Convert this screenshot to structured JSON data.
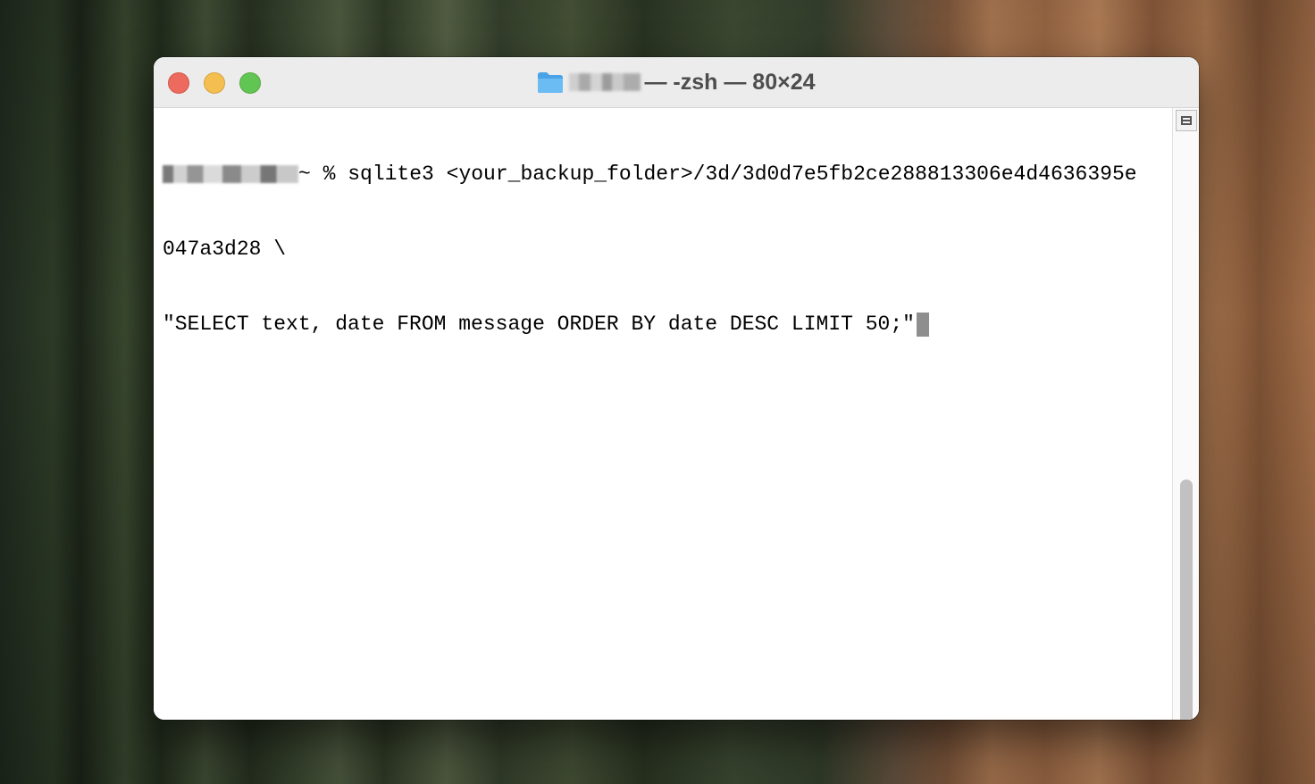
{
  "window": {
    "title_suffix": "— -zsh — 80×24"
  },
  "terminal": {
    "prompt_suffix": "~ % ",
    "command_line1": "sqlite3 <your_backup_folder>/3d/3d0d7e5fb2ce288813306e4d4636395e",
    "command_line2": "047a3d28 \\",
    "command_line3": "\"SELECT text, date FROM message ORDER BY date DESC LIMIT 50;\""
  },
  "colors": {
    "close": "#ed6a5e",
    "minimize": "#f5bf4f",
    "maximize": "#61c554",
    "folder": "#5ab1f0"
  },
  "icons": {
    "title": "folder-icon",
    "scrollbar_top": "split-pane-icon"
  }
}
